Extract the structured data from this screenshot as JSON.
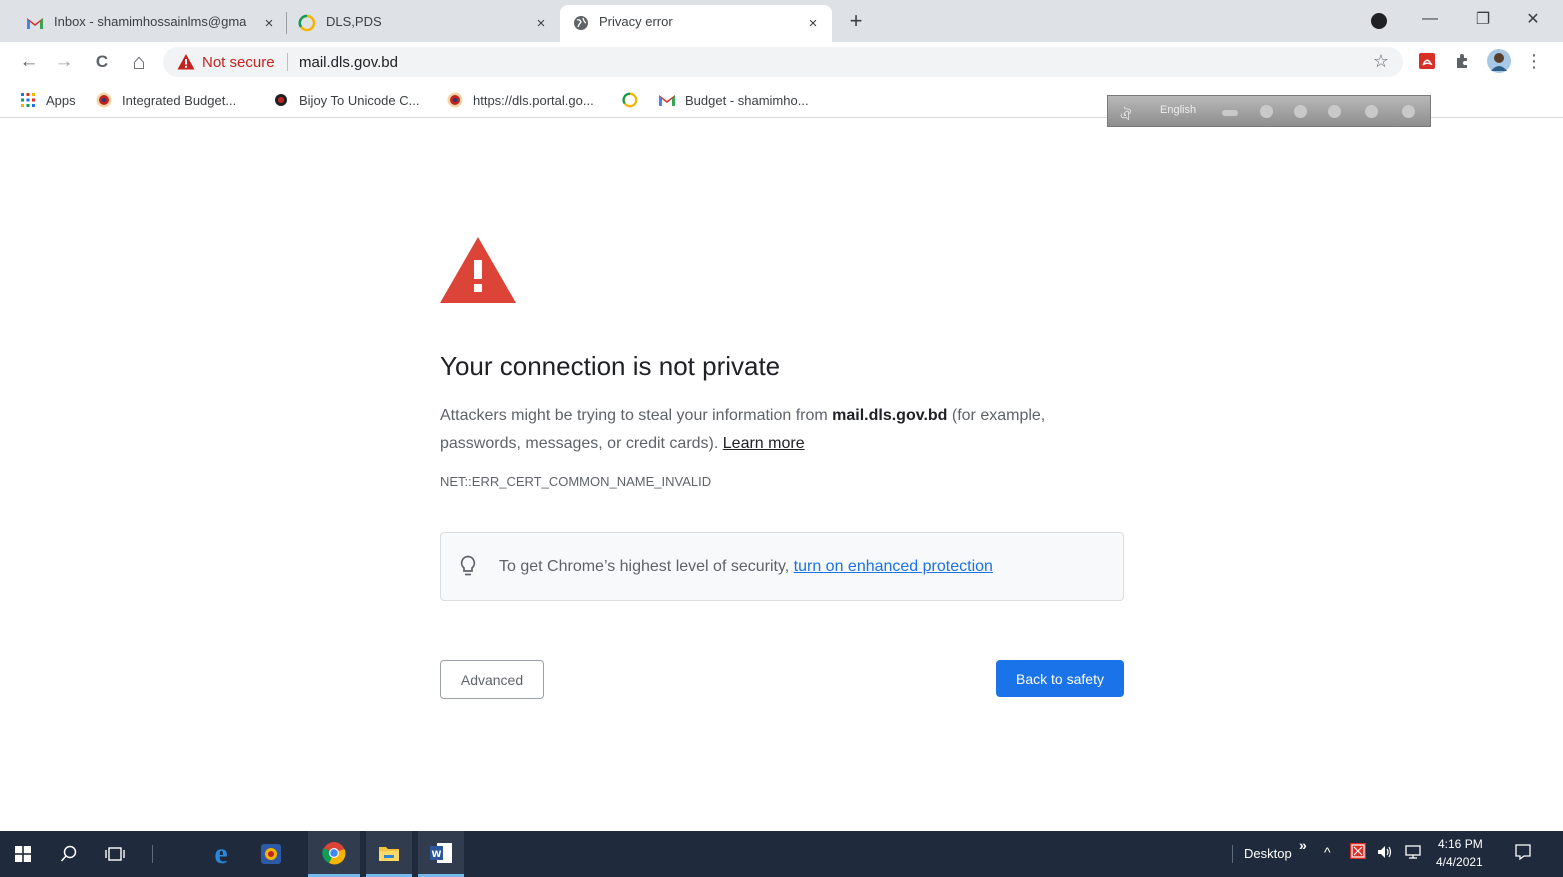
{
  "tabs": [
    {
      "title": "Inbox - shamimhossainlms@gma",
      "icon": "gmail-icon",
      "close": "×"
    },
    {
      "title": "DLS,PDS",
      "icon": "dls-icon",
      "close": "×"
    },
    {
      "title": "Privacy error",
      "icon": "globe-icon",
      "close": "×"
    }
  ],
  "new_tab": "+",
  "window_controls": {
    "minimize": "—",
    "restore": "❐",
    "close": "✕"
  },
  "toolbar": {
    "back": "←",
    "forward": "→",
    "reload": "C",
    "home": "⌂",
    "not_secure_label": "Not secure",
    "url": "mail.dls.gov.bd",
    "star": "☆",
    "menu": "⋮"
  },
  "bookmarks": [
    {
      "label": "Apps",
      "icon": "apps-grid-icon"
    },
    {
      "label": "Integrated Budget...",
      "icon": "budget-site-icon"
    },
    {
      "label": "Bijoy To Unicode C...",
      "icon": "circle-icon"
    },
    {
      "label": "https://dls.portal.go...",
      "icon": "portal-icon"
    },
    {
      "label": "",
      "icon": "dls-icon"
    },
    {
      "label": "Budget - shamimho...",
      "icon": "gmail-icon"
    }
  ],
  "language_bar": {
    "language": "English"
  },
  "interstitial": {
    "heading": "Your connection is not private",
    "body_prefix": "Attackers might be trying to steal your information from ",
    "domain": "mail.dls.gov.bd",
    "body_suffix": " (for example, passwords, messages, or credit cards). ",
    "learn_more": "Learn more",
    "error_code": "NET::ERR_CERT_COMMON_NAME_INVALID",
    "enhanced_prefix": "To get Chrome’s highest level of security, ",
    "enhanced_link": "turn on enhanced protection",
    "advanced_button": "Advanced",
    "back_button": "Back to safety"
  },
  "taskbar": {
    "desktop_label": "Desktop",
    "overflow": "»",
    "time": "4:16 PM",
    "date": "4/4/2021"
  },
  "colors": {
    "accent": "#1a73e8",
    "danger": "#d93025",
    "taskbar": "#1f2a3d"
  }
}
